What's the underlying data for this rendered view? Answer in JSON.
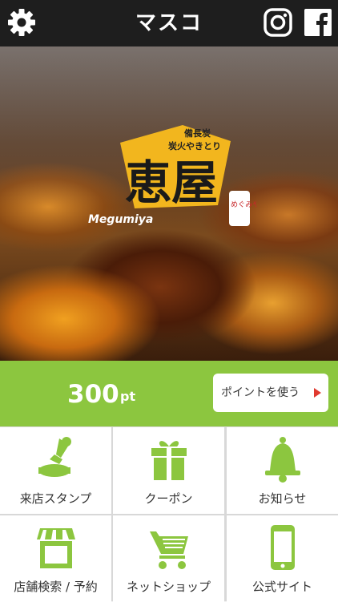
{
  "header": {
    "title": "マスコ",
    "settings_icon": "gear-icon",
    "instagram_icon": "instagram-icon",
    "facebook_icon": "facebook-icon"
  },
  "hero": {
    "logo": {
      "sub_line1": "備長炭",
      "sub_line2": "炭火やきとり",
      "name": "恵屋",
      "romaji": "Megumiya",
      "stamp": "めぐみや"
    }
  },
  "points": {
    "value": "300",
    "unit": "pt",
    "use_button_label": "ポイントを使う"
  },
  "menu": [
    {
      "label": "来店スタンプ",
      "icon": "stamp-icon"
    },
    {
      "label": "クーポン",
      "icon": "gift-icon"
    },
    {
      "label": "お知らせ",
      "icon": "bell-icon"
    },
    {
      "label": "店舗検索 / 予約",
      "icon": "store-icon"
    },
    {
      "label": "ネットショップ",
      "icon": "cart-icon"
    },
    {
      "label": "公式サイト",
      "icon": "smartphone-icon"
    }
  ],
  "colors": {
    "header_bg": "#1e1e1e",
    "accent_green": "#8cc63f",
    "arrow_red": "#e0392f"
  }
}
